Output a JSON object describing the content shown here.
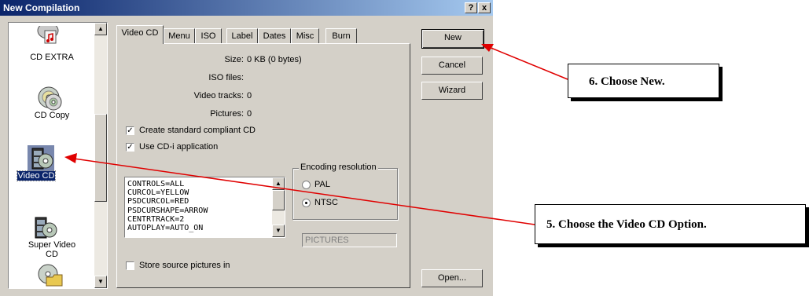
{
  "window": {
    "title": "New Compilation",
    "help_btn": "?",
    "close_btn": "x"
  },
  "compilation_types": [
    {
      "label": "CD EXTRA",
      "icon": "cd-extra-icon"
    },
    {
      "label": "CD Copy",
      "icon": "cd-copy-icon"
    },
    {
      "label": "Video CD",
      "icon": "video-cd-icon",
      "selected": true
    },
    {
      "label_line1": "Super Video",
      "label_line2": "CD",
      "icon": "super-video-cd-icon"
    },
    {
      "label": "",
      "icon": "cd-folder-icon"
    }
  ],
  "tabs": [
    "Video CD",
    "Menu",
    "ISO",
    "Label",
    "Dates",
    "Misc",
    "Burn"
  ],
  "active_tab": "Video CD",
  "info": {
    "size_label": "Size:",
    "size_value": "0 KB (0 bytes)",
    "iso_label": "ISO files:",
    "iso_value": "",
    "tracks_label": "Video tracks:",
    "tracks_value": "0",
    "pictures_label": "Pictures:",
    "pictures_value": "0"
  },
  "options": {
    "standard_compliant": {
      "label": "Create standard compliant CD",
      "checked": true
    },
    "cdi_app": {
      "label": "Use CD-i application",
      "checked": true
    },
    "store_pictures": {
      "label": "Store source pictures in",
      "checked": false
    }
  },
  "encoding": {
    "title": "Encoding resolution",
    "pal": "PAL",
    "ntsc": "NTSC",
    "selected": "NTSC"
  },
  "cdi_settings": [
    "CONTROLS=ALL",
    "CURCOL=YELLOW",
    "PSDCURCOL=RED",
    "PSDCURSHAPE=ARROW",
    "CENTRTRACK=2",
    "AUTOPLAY=AUTO_ON"
  ],
  "pictures_folder": "PICTURES",
  "buttons": {
    "new": "New",
    "cancel": "Cancel",
    "wizard": "Wizard",
    "open": "Open..."
  },
  "callouts": {
    "step6": "6.  Choose New.",
    "step5": "5.  Choose the Video CD Option."
  },
  "annotation_color": "#e00000"
}
